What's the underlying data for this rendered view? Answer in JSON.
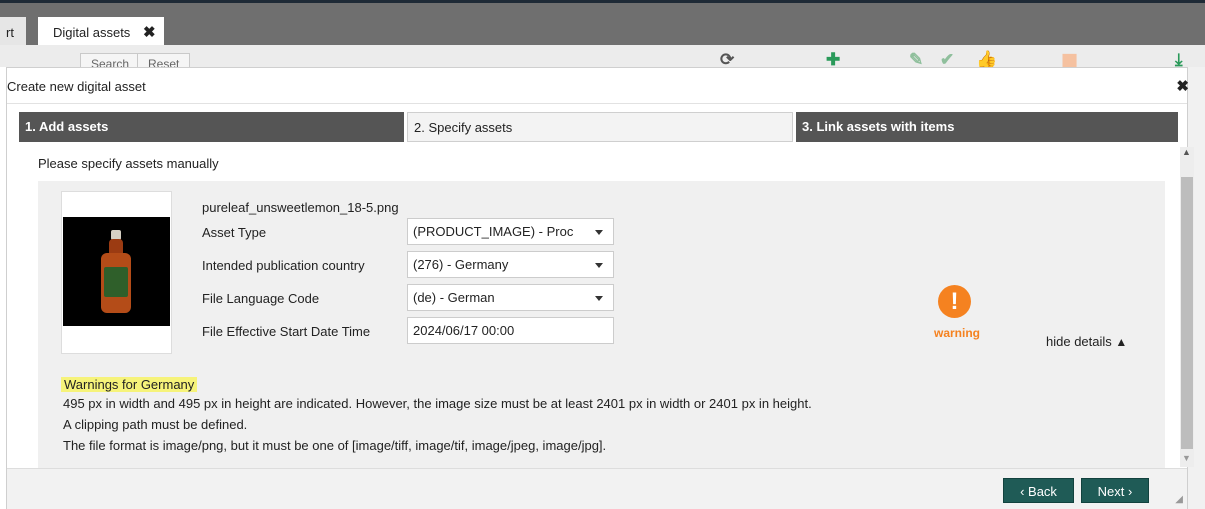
{
  "tabs": {
    "prev_label": "rt",
    "active_label": "Digital assets",
    "close_symbol": "✖"
  },
  "toolbar": {
    "search_label": "Search",
    "reset_label": "Reset",
    "icons": [
      "refresh-icon",
      "plus-icon",
      "pencil-icon",
      "check-icon",
      "thumbs-up-icon",
      "trash-icon",
      "download-icon"
    ]
  },
  "modal": {
    "title": "Create new digital asset",
    "close_symbol": "✖",
    "steps": [
      "1. Add assets",
      "2. Specify assets",
      "3. Link assets with items"
    ],
    "subtitle": "Please specify assets manually"
  },
  "asset": {
    "filename": "pureleaf_unsweetlemon_18-5.png",
    "fields": [
      {
        "label": "Asset Type",
        "value": "(PRODUCT_IMAGE) - Proc",
        "dropdown": true
      },
      {
        "label": "Intended publication country",
        "value": "(276) - Germany",
        "dropdown": true
      },
      {
        "label": "File Language Code",
        "value": "(de) - German",
        "dropdown": true
      },
      {
        "label": "File Effective Start Date Time",
        "value": "2024/06/17 00:00",
        "dropdown": false
      }
    ],
    "status": {
      "text": "warning",
      "icon": "warning-icon",
      "color": "#f58220"
    },
    "hide_details": "hide details"
  },
  "warnings": {
    "heading": "Warnings for Germany",
    "lines": [
      "495 px in width and 495 px in height are indicated. However, the image size must be at least 2401 px in width or 2401 px in height.",
      "A clipping path must be defined.",
      "The file format is image/png, but it must be one of [image/tiff, image/tif, image/jpeg, image/jpg]."
    ]
  },
  "footer": {
    "back_label": "‹ Back",
    "next_label": "Next ›",
    "button_color": "#1f5b56"
  }
}
